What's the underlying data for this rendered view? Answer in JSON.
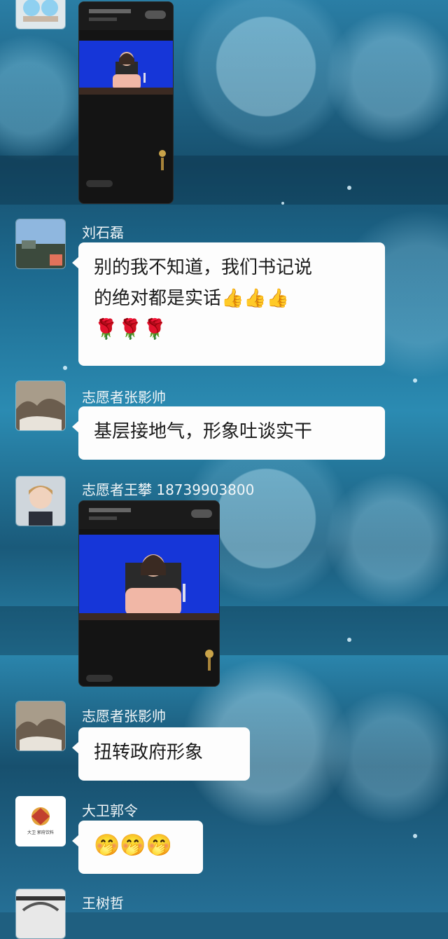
{
  "messages": [
    {
      "sender": "刘石磊",
      "text_lines": [
        "别的我不知道，我们书记说",
        "的绝对都是实话👍👍👍"
      ],
      "emoji_line": "🌹🌹🌹"
    },
    {
      "sender": "志愿者张影帅",
      "text": "基层接地气，形象吐谈实干"
    },
    {
      "sender": "志愿者王攀 18739903800"
    },
    {
      "sender": "志愿者张影帅",
      "text": "扭转政府形象"
    },
    {
      "sender": "大卫郭令",
      "text": "🤭🤭🤭"
    },
    {
      "sender": "王树哲"
    }
  ],
  "logo_text": "大卫 郭府饮料",
  "colors": {
    "bubble": "#fdfdfd",
    "screen_blue": "#1636d8",
    "name_text": "#f2f6f8"
  }
}
